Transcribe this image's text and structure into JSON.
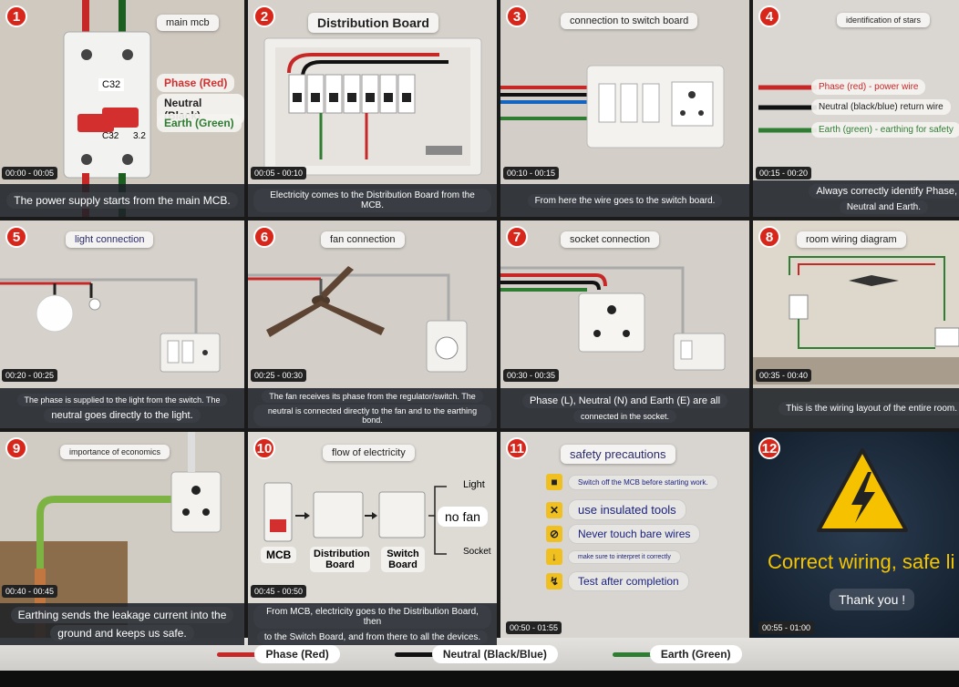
{
  "panels": [
    {
      "n": "1",
      "title": "main mcb",
      "time": "00:00 - 00:05",
      "caption": [
        "The power supply starts from the main MCB."
      ],
      "labels": {
        "phase": "Phase (Red)",
        "neutral": "Neutral (Black)",
        "earth": "Earth (Green)",
        "c32a": "C32",
        "c32b": "C32",
        "c32c": "3.2"
      }
    },
    {
      "n": "2",
      "title": "Distribution Board",
      "time": "00:05 - 00:10",
      "caption": [
        "Electricity comes to the Distribution Board from the MCB."
      ]
    },
    {
      "n": "3",
      "title": "connection to switch board",
      "time": "00:10 - 00:15",
      "caption": [
        "From here the wire goes to the switch board."
      ]
    },
    {
      "n": "4",
      "title": "identification of stars",
      "time": "00:15 - 00:20",
      "caption": [
        "Always correctly identify Phase,",
        "Neutral and Earth."
      ],
      "labels": {
        "phase": "Phase (red) - power wire",
        "neutral": "Neutral (black/blue) return wire",
        "earth": "Earth (green) - earthing for safety"
      }
    },
    {
      "n": "5",
      "title": "light connection",
      "time": "00:20 - 00:25",
      "caption": [
        "The phase is supplied to the light from the switch. The",
        "neutral goes directly to the light."
      ]
    },
    {
      "n": "6",
      "title": "fan connection",
      "time": "00:25 - 00:30",
      "caption": [
        "The fan receives its phase from the regulator/switch. The",
        "neutral is connected directly to the fan and to the earthing bond."
      ]
    },
    {
      "n": "7",
      "title": "socket connection",
      "time": "00:30 - 00:35",
      "caption": [
        "Phase (L), Neutral (N) and Earth (E) are all",
        "connected in the socket."
      ]
    },
    {
      "n": "8",
      "title": "room wiring diagram",
      "time": "00:35 - 00:40",
      "caption": [
        "This is the wiring layout of the entire room."
      ]
    },
    {
      "n": "9",
      "title": "importance of economics",
      "time": "00:40 - 00:45",
      "caption": [
        "Earthing sends the leakage current into the",
        "ground and keeps us safe."
      ]
    },
    {
      "n": "10",
      "title": "flow of electricity",
      "time": "00:45 - 00:50",
      "caption": [
        "From MCB, electricity goes to the Distribution Board, then",
        "to the Switch Board, and from there to all the devices."
      ],
      "flow": {
        "mcb": "MCB",
        "db": "Distribution Board",
        "sb": "Switch Board",
        "light": "Light",
        "nofan": "no fan",
        "socket": "Socket"
      }
    },
    {
      "n": "11",
      "title": "safety precautions",
      "time": "00:50 - 01:55",
      "steps": [
        "Switch off the MCB before starting work.",
        "use insulated tools",
        "Never touch bare wires",
        "make sure to interpret it correctly",
        "Test after completion"
      ]
    },
    {
      "n": "12",
      "time": "00:55 - 01:00",
      "headline": "Correct wiring, safe li",
      "thanks": "Thank you !"
    }
  ],
  "legend": [
    {
      "label": "Phase (Red)",
      "color": "#c62828"
    },
    {
      "label": "Neutral (Black/Blue)",
      "color": "#111111"
    },
    {
      "label": "Earth (Green)",
      "color": "#2e7d32"
    }
  ]
}
